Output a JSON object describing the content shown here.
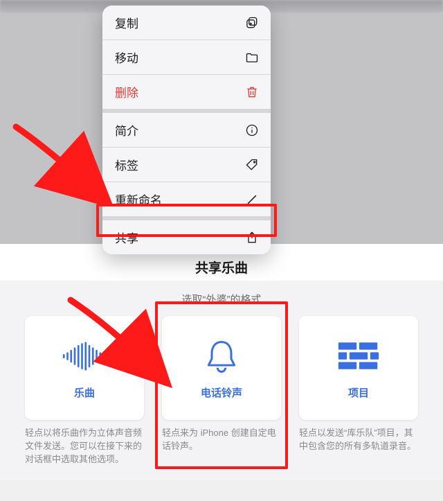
{
  "menu": {
    "copy": "复制",
    "move": "移动",
    "delete": "删除",
    "info": "简介",
    "tags": "标签",
    "rename": "重新命名",
    "share": "共享"
  },
  "sheet": {
    "title": "共享乐曲",
    "subtitle": "选取“外婆”的格式"
  },
  "cards": {
    "song": {
      "label": "乐曲",
      "desc": "轻点以将乐曲作为立体声音频文件发送。您可以在接下来的对话框中选取其他选项。"
    },
    "ringtone": {
      "label": "电话铃声",
      "desc": "轻点来为 iPhone 创建自定电话铃声。"
    },
    "project": {
      "label": "项目",
      "desc": "轻点以发送“库乐队”项目，其中包含您的所有多轨道录音。"
    }
  },
  "colors": {
    "accent": "#3a6fe0",
    "danger": "#e63b30",
    "highlight": "#ff1a1a"
  }
}
